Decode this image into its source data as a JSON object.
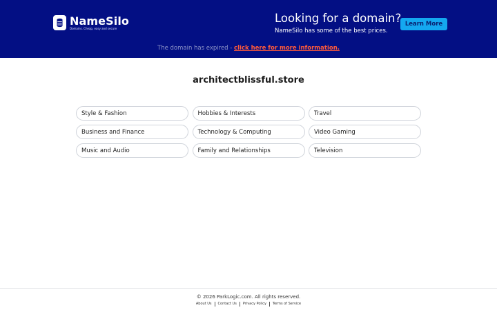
{
  "header": {
    "logo": {
      "name": "NameSilo",
      "tagline": "Domains. Cheap, easy and secure"
    },
    "promo": {
      "heading": "Looking for a domain?",
      "subtext": "NameSilo has some of the best prices.",
      "button_label": "Learn More"
    },
    "notice": {
      "text": "The domain has expired - ",
      "link_label": "click here for more information."
    }
  },
  "main": {
    "domain": "architectblissful.store",
    "categories": [
      "Style & Fashion",
      "Hobbies & Interests",
      "Travel",
      "Business and Finance",
      "Technology & Computing",
      "Video Gaming",
      "Music and Audio",
      "Family and Relationships",
      "Television"
    ]
  },
  "footer": {
    "copyright": "© 2026 ParkLogic.com. All rights reserved.",
    "links": [
      "About Us",
      "Contact Us",
      "Privacy Policy",
      "Terms of Service"
    ]
  },
  "colors": {
    "banner": "#030f84",
    "button": "#14a8f0",
    "notice_link": "#ff5a3a"
  }
}
